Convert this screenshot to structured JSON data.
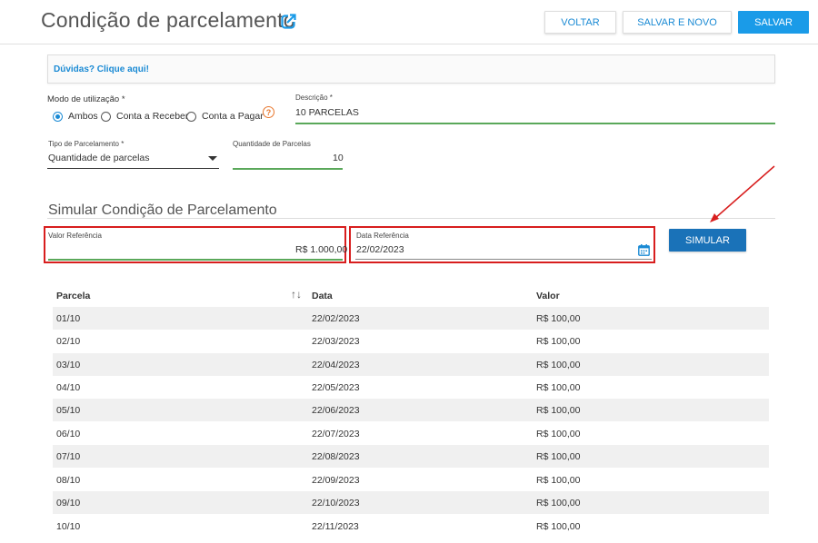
{
  "header": {
    "title": "Condição de parcelamento",
    "buttons": {
      "back": "VOLTAR",
      "save_new": "SALVAR E NOVO",
      "save": "SALVAR"
    }
  },
  "help": {
    "link_text": "Dúvidas? Clique aqui!"
  },
  "form": {
    "usage_mode": {
      "label": "Modo de utilização *",
      "options": [
        "Ambos",
        "Conta a Receber",
        "Conta a Pagar"
      ],
      "selected": "Ambos"
    },
    "description": {
      "label": "Descrição *",
      "value": "10 PARCELAS"
    },
    "installment_type": {
      "label": "Tipo de Parcelamento *",
      "value": "Quantidade de parcelas"
    },
    "installment_qty": {
      "label": "Quantidade de Parcelas",
      "value": "10"
    }
  },
  "simulation": {
    "title": "Simular Condição de Parcelamento",
    "reference_value": {
      "label": "Valor Referência",
      "value": "R$ 1.000,00"
    },
    "reference_date": {
      "label": "Data Referência",
      "value": "22/02/2023"
    },
    "button": "SIMULAR"
  },
  "table": {
    "columns": [
      "Parcela",
      "Data",
      "Valor"
    ],
    "rows": [
      [
        "01/10",
        "22/02/2023",
        "R$ 100,00"
      ],
      [
        "02/10",
        "22/03/2023",
        "R$ 100,00"
      ],
      [
        "03/10",
        "22/04/2023",
        "R$ 100,00"
      ],
      [
        "04/10",
        "22/05/2023",
        "R$ 100,00"
      ],
      [
        "05/10",
        "22/06/2023",
        "R$ 100,00"
      ],
      [
        "06/10",
        "22/07/2023",
        "R$ 100,00"
      ],
      [
        "07/10",
        "22/08/2023",
        "R$ 100,00"
      ],
      [
        "08/10",
        "22/09/2023",
        "R$ 100,00"
      ],
      [
        "09/10",
        "22/10/2023",
        "R$ 100,00"
      ],
      [
        "10/10",
        "22/11/2023",
        "R$ 100,00"
      ]
    ]
  },
  "colors": {
    "primary": "#1a9be8",
    "accent_blue": "#1a8ad4",
    "annotation_red": "#d81e1e",
    "valid_green": "#5aa85a",
    "help_orange": "#e8772e"
  },
  "icons": [
    "external-link-icon",
    "help-circle-icon",
    "dropdown-caret-icon",
    "calendar-icon",
    "sort-icon"
  ]
}
